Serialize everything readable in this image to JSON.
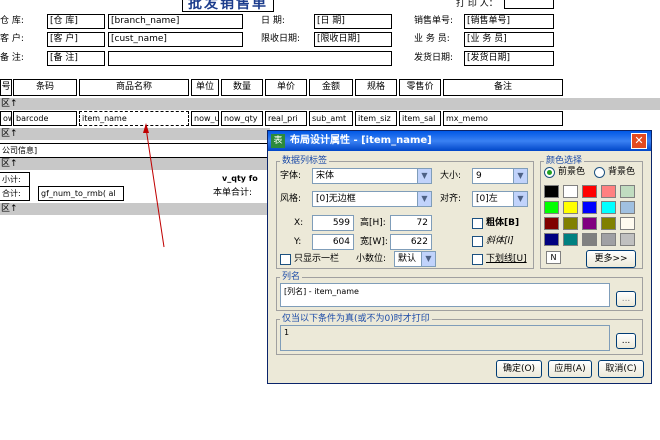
{
  "report": {
    "title": "批发销售单",
    "printer_label": "打 印 人：",
    "header_fields": [
      {
        "label": "仓    库:",
        "key": "[仓    库]",
        "value": "[branch_name]"
      },
      {
        "label": "客    户:",
        "key": "[客    户]",
        "value": "[cust_name]"
      },
      {
        "label": "备    注:",
        "key": "[备    注]",
        "value": ""
      }
    ],
    "right_fields": [
      {
        "label": "日    期:",
        "value": "[日    期]"
      },
      {
        "label": "限收日期:",
        "value": "[限收日期]"
      },
      {
        "label": "销售单号:",
        "value": "[销售单号]"
      },
      {
        "label": "业 务 员:",
        "value": "[业 务 员]"
      },
      {
        "label": "发货日期:",
        "value": "[发货日期]"
      }
    ],
    "columns": [
      "号",
      "条码",
      "商品名称",
      "单位",
      "数量",
      "单价",
      "金额",
      "规格",
      "零售价",
      "备注"
    ],
    "detail_cells": [
      "ow",
      "barcode",
      "item_name",
      "now_u",
      "now_qty",
      "real_pri",
      "sub_amt",
      "item_siz",
      "item_sal",
      "mx_memo"
    ],
    "bands": [
      "区↑",
      "区↑",
      "区↑",
      "区↑"
    ],
    "company_info": "公司信息]",
    "subtotal_label": "小计:",
    "total_label": "合计:",
    "total_field": "gf_num_to_rmb( al",
    "qty_field": "v_qty fo",
    "page_total_label": "本单合计:"
  },
  "dialog": {
    "title": "布局设计属性 - [item_name]",
    "app_icon": "表",
    "close_icon": "close-icon",
    "data_label_group": "数据列标签",
    "font_label": "字体:",
    "font_value": "宋体",
    "size_label": "大小:",
    "size_value": "9",
    "style_label": "风格:",
    "style_value": "[0]无边框",
    "align_label": "对齐:",
    "align_value": "[0]左",
    "x_label": "X:",
    "x_value": "599",
    "h_label": "高[H]:",
    "h_value": "72",
    "y_label": "Y:",
    "y_value": "604",
    "w_label": "宽[W]:",
    "w_value": "622",
    "bold_label": "粗体[B]",
    "italic_label": "斜体[I]",
    "underline_label": "下划线[U]",
    "show_one_label": "只显示一栏",
    "decimals_label": "小数位:",
    "decimals_value": "默认",
    "color_group": "颜色选择",
    "fg_label": "前景色",
    "bg_label": "背景色",
    "color_indicator": "N",
    "more_label": "更多>>",
    "colors": [
      "#000000",
      "#ffffff",
      "#ff0000",
      "#ff8080",
      "#c0dcc0",
      "#00ff00",
      "#ffff00",
      "#0000ff",
      "#00ffff",
      "#a0c0e0",
      "#800000",
      "#808000",
      "#800080",
      "#808000",
      "#fffbf0",
      "#000080",
      "#008080",
      "#808080",
      "#a0a0a4",
      "#c0c0c0"
    ],
    "colname_group": "列名",
    "colname_value": "[列名] - item_name",
    "cond_group": "仅当以下条件为真(或不为0)时才打印",
    "cond_value": "1",
    "browse_label": "...",
    "ok_label": "确定(O)",
    "apply_label": "应用(A)",
    "cancel_label": "取消(C)"
  }
}
